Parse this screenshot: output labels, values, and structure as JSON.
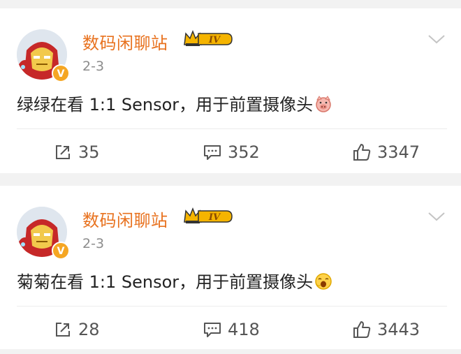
{
  "posts": [
    {
      "username": "数码闲聊站",
      "level_badge": "IV",
      "time": "2-3",
      "content": "绿绿在看 1:1 Sensor，用于前置摄像头",
      "emoji_icon": "pig-face-icon",
      "shares": "35",
      "comments": "352",
      "likes": "3347"
    },
    {
      "username": "数码闲聊站",
      "level_badge": "IV",
      "time": "2-3",
      "content": "菊菊在看 1:1 Sensor，用于前置摄像头",
      "emoji_icon": "yawn-face-icon",
      "shares": "28",
      "comments": "418",
      "likes": "3443"
    }
  ],
  "colors": {
    "username": "#e8721f",
    "verified": "#f5a623",
    "badge": "#f5b400"
  }
}
